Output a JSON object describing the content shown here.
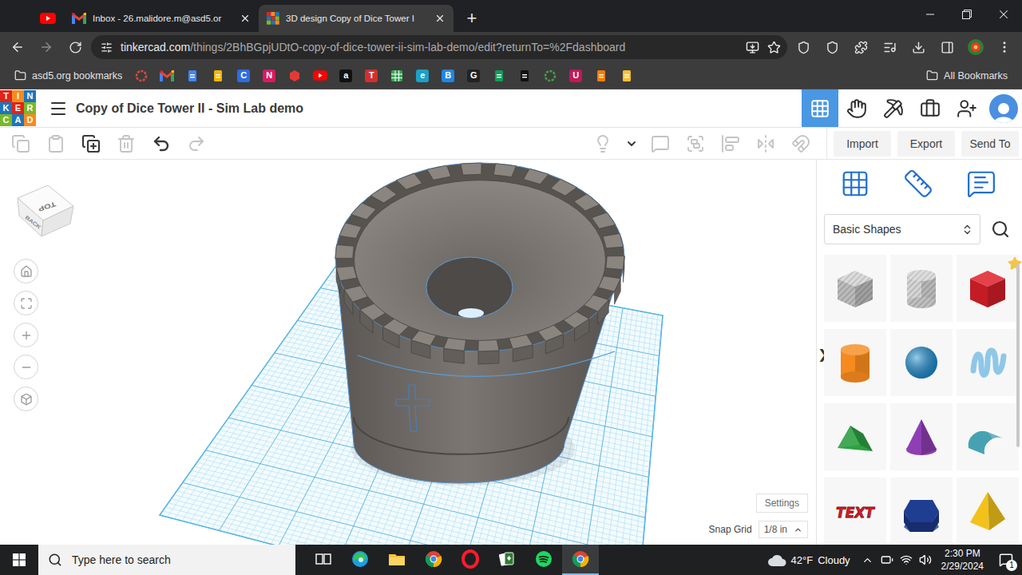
{
  "browser": {
    "tabs": [
      {
        "kind": "youtube",
        "pinned": true,
        "selected": false
      },
      {
        "kind": "gmail",
        "pinned": false,
        "title": "Inbox - 26.malidore.m@asd5.or",
        "selected": false
      },
      {
        "kind": "tinkercad",
        "pinned": false,
        "title": "3D design Copy of Dice Tower I",
        "selected": true
      }
    ],
    "new_tab": "+",
    "url_host": "tinkercad.com",
    "url_path": "/things/2BhBGpjUDtO-copy-of-dice-tower-ii-sim-lab-demo/edit?returnTo=%2Fdashboard",
    "bookmarks_folder": "asd5.org bookmarks",
    "bookmarks": [
      {
        "kind": "ring",
        "glyph": "",
        "color": "#e8453c"
      },
      {
        "kind": "gmail",
        "glyph": "",
        "color": "#ea4335"
      },
      {
        "kind": "doc",
        "glyph": "",
        "color": "#4285f4"
      },
      {
        "kind": "doc",
        "glyph": "",
        "color": "#f4b400"
      },
      {
        "kind": "letter",
        "glyph": "C",
        "color": "#2b6de3"
      },
      {
        "kind": "letter",
        "glyph": "N",
        "color": "#d81b60"
      },
      {
        "kind": "hex",
        "glyph": "",
        "color": "#e53935"
      },
      {
        "kind": "youtube",
        "glyph": "",
        "color": "#ff0000"
      },
      {
        "kind": "letter",
        "glyph": "a",
        "color": "#111111"
      },
      {
        "kind": "letter",
        "glyph": "T",
        "color": "#d32f2f"
      },
      {
        "kind": "grid",
        "glyph": "",
        "color": "#34a853"
      },
      {
        "kind": "letter",
        "glyph": "e",
        "color": "#1ba1c5"
      },
      {
        "kind": "letter",
        "glyph": "B",
        "color": "#1e88e5"
      },
      {
        "kind": "letter",
        "glyph": "G",
        "color": "#222222"
      },
      {
        "kind": "doc",
        "glyph": "",
        "color": "#0f9d58"
      },
      {
        "kind": "doc",
        "glyph": "",
        "color": "#111111"
      },
      {
        "kind": "ring",
        "glyph": "",
        "color": "#43a047"
      },
      {
        "kind": "letter",
        "glyph": "U",
        "color": "#c2185b"
      },
      {
        "kind": "doc",
        "glyph": "",
        "color": "#f57c00"
      },
      {
        "kind": "doc",
        "glyph": "",
        "color": "#fbc02d"
      }
    ],
    "all_bookmarks": "All Bookmarks"
  },
  "app": {
    "logo": [
      {
        "letter": "T",
        "color": "#e2231a"
      },
      {
        "letter": "I",
        "color": "#f68b1f"
      },
      {
        "letter": "N",
        "color": "#1d75bc"
      },
      {
        "letter": "K",
        "color": "#1d75bc"
      },
      {
        "letter": "E",
        "color": "#e2231a"
      },
      {
        "letter": "R",
        "color": "#79b829"
      },
      {
        "letter": "C",
        "color": "#79b829"
      },
      {
        "letter": "A",
        "color": "#1d75bc"
      },
      {
        "letter": "D",
        "color": "#f68b1f"
      }
    ],
    "title": "Copy of Dice Tower II - Sim Lab demo",
    "nav": [
      {
        "kind": "designs",
        "selected": true
      },
      {
        "kind": "learn",
        "selected": false
      },
      {
        "kind": "build",
        "selected": false
      },
      {
        "kind": "projects",
        "selected": false
      },
      {
        "kind": "invite",
        "selected": false
      },
      {
        "kind": "avatar",
        "selected": false
      }
    ],
    "edit_tools": [
      {
        "kind": "copy",
        "disabled": true
      },
      {
        "kind": "paste",
        "disabled": true
      },
      {
        "kind": "duplicate",
        "disabled": false
      },
      {
        "kind": "delete",
        "disabled": true
      },
      {
        "kind": "undo",
        "disabled": false
      },
      {
        "kind": "redo",
        "disabled": true
      }
    ],
    "shape_tools": [
      {
        "kind": "bulb",
        "disabled": true
      },
      {
        "kind": "dropdown",
        "disabled": false
      },
      {
        "kind": "note",
        "disabled": true
      },
      {
        "kind": "group",
        "disabled": true
      },
      {
        "kind": "align",
        "disabled": true
      },
      {
        "kind": "mirror",
        "disabled": true
      },
      {
        "kind": "cruise",
        "disabled": true
      }
    ],
    "actions": [
      "Import",
      "Export",
      "Send To"
    ],
    "viewcube": {
      "top": "TOP",
      "back": "BACK"
    },
    "view_controls": [
      {
        "kind": "home"
      },
      {
        "kind": "fit"
      },
      {
        "kind": "zoom-in"
      },
      {
        "kind": "zoom-out"
      },
      {
        "kind": "ortho"
      }
    ],
    "panel_toggle": "❯",
    "settings": "Settings",
    "snap_grid": {
      "label": "Snap Grid",
      "value": "1/8 in"
    },
    "panel": {
      "tools": [
        {
          "kind": "workplane"
        },
        {
          "kind": "ruler"
        },
        {
          "kind": "notes"
        }
      ],
      "category": "Basic Shapes",
      "shapes": [
        {
          "kind": "box",
          "hole": true,
          "favorite": false,
          "color": "#c9c9c9",
          "label": ""
        },
        {
          "kind": "cylinder",
          "hole": true,
          "favorite": false,
          "color": "#c9c9c9",
          "label": ""
        },
        {
          "kind": "box",
          "hole": false,
          "favorite": true,
          "color": "#e0202a",
          "label": ""
        },
        {
          "kind": "cylinder",
          "hole": false,
          "favorite": false,
          "color": "#f58a1f",
          "label": ""
        },
        {
          "kind": "sphere",
          "hole": false,
          "favorite": false,
          "color": "#1a8fd6",
          "label": ""
        },
        {
          "kind": "scribble",
          "hole": false,
          "favorite": false,
          "color": "#8fc7e8",
          "label": ""
        },
        {
          "kind": "roof",
          "hole": false,
          "favorite": false,
          "color": "#2ea043",
          "label": ""
        },
        {
          "kind": "cone",
          "hole": false,
          "favorite": false,
          "color": "#8e3fb3",
          "label": ""
        },
        {
          "kind": "round-roof",
          "hole": false,
          "favorite": false,
          "color": "#4fb5c8",
          "label": ""
        },
        {
          "kind": "text",
          "hole": false,
          "favorite": false,
          "color": "#d81e28",
          "label": "TEXT"
        },
        {
          "kind": "polygon",
          "hole": false,
          "favorite": false,
          "color": "#1f3d91",
          "label": ""
        },
        {
          "kind": "pyramid",
          "hole": false,
          "favorite": false,
          "color": "#f2c21b",
          "label": ""
        }
      ]
    }
  },
  "taskbar": {
    "search": "Type here to search",
    "apps": [
      {
        "kind": "task-view",
        "active": false
      },
      {
        "kind": "edge",
        "active": false
      },
      {
        "kind": "explorer",
        "active": false
      },
      {
        "kind": "chrome",
        "active": false
      },
      {
        "kind": "opera",
        "active": false
      },
      {
        "kind": "solitaire",
        "active": false
      },
      {
        "kind": "spotify",
        "active": false
      },
      {
        "kind": "chrome",
        "active": true
      }
    ],
    "weather": {
      "temp": "42°F",
      "condition": "Cloudy"
    },
    "time": "2:30 PM",
    "date": "2/29/2024",
    "notifications": "1"
  }
}
